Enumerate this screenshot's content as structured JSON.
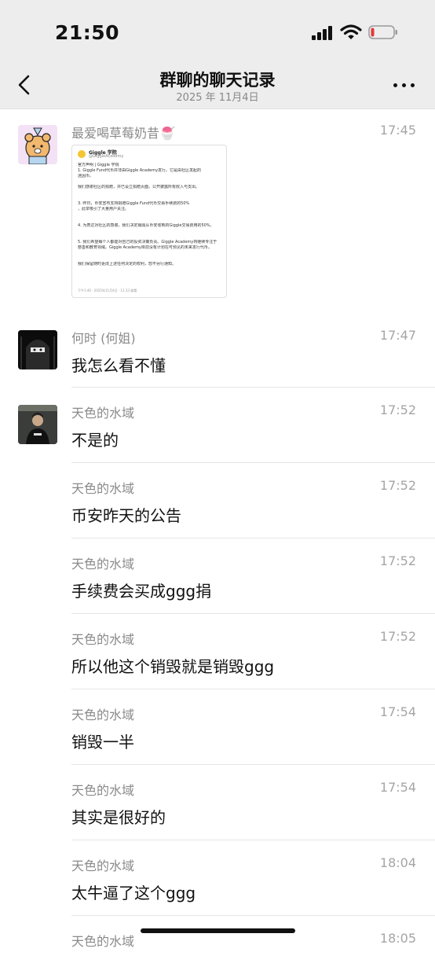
{
  "status": {
    "time": "21:50"
  },
  "nav": {
    "title": "群聊的聊天记录",
    "subtitle": "2025 年 11月4日"
  },
  "shared_card": {
    "account_name": "Giggle 学院",
    "account_handle": "@GiggleAcademy",
    "heading": "官方声明 | Giggle 学院",
    "lines": [
      "1. Giggle Fund代币并非由Giggle Academy发行。它是由社区发起的",
      "迷因币。",
      "",
      "我们感谢社区的捐赠，并已设立捐赠页面，公开披露所有收入与支出。",
      "",
      "3. 昨日，币安宣布支持捐赠Giggle Fund代币交易手续费的50%",
      "，此举吸引了大量用户关注。",
      "",
      "4. 为表达对社区的感谢，我们决定销毁从币安收到的Giggle交易费用的50%。",
      "",
      "5. 我们希望每个人都能对自己的投资决策负责。Giggle Academy将继续专注于",
      "慈善和教育领域。Giggle Academy目前没有计划在可预见的未来发行代币。",
      "",
      "我们保留随时更改上述任何决定的权利，恕不另行通知。"
    ],
    "footer": "下午1:40 · 2025年11月4日 · 12.3万查看"
  },
  "messages": [
    {
      "sender": "最爱喝草莓奶昔🍧",
      "time": "17:45",
      "type": "card"
    },
    {
      "sender": "何时 (何姐)",
      "time": "17:47",
      "text": "我怎么看不懂"
    },
    {
      "sender": "天色的水域",
      "time": "17:52",
      "text": "不是的"
    },
    {
      "sender": "天色的水域",
      "time": "17:52",
      "text": "币安昨天的公告"
    },
    {
      "sender": "天色的水域",
      "time": "17:52",
      "text": "手续费会买成ggg捐"
    },
    {
      "sender": "天色的水域",
      "time": "17:52",
      "text": "所以他这个销毁就是销毁ggg"
    },
    {
      "sender": "天色的水域",
      "time": "17:54",
      "text": "销毁一半"
    },
    {
      "sender": "天色的水域",
      "time": "17:54",
      "text": "其实是很好的"
    },
    {
      "sender": "天色的水域",
      "time": "18:04",
      "text": "太牛逼了这个ggg"
    },
    {
      "sender": "天色的水域",
      "time": "18:05",
      "text": ""
    }
  ],
  "colors": {
    "header_bg": "#ededed",
    "body_bg": "#ffffff",
    "meta_text": "#8a8a8a"
  },
  "icons": [
    "back-chevron-icon",
    "more-dots-icon",
    "signal-icon",
    "wifi-icon",
    "battery-icon"
  ]
}
